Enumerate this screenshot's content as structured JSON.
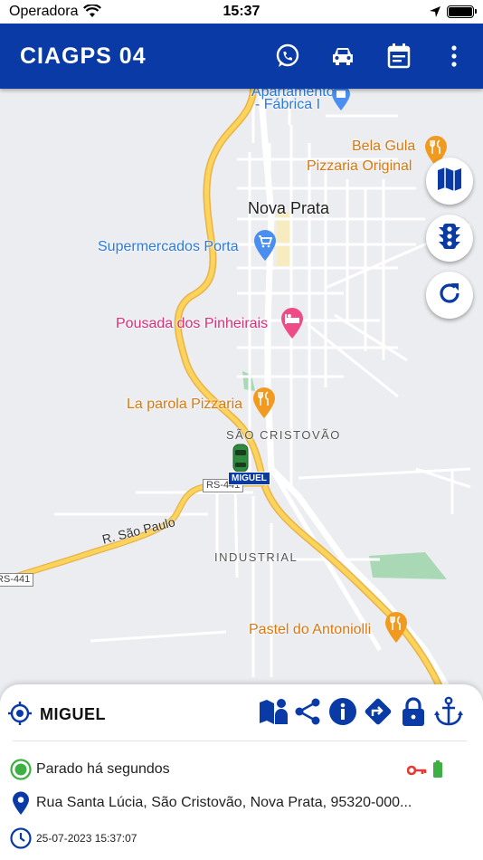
{
  "status_bar": {
    "carrier": "Operadora",
    "time": "15:37",
    "icons": [
      "wifi-icon",
      "location-arrow-icon",
      "battery-icon"
    ]
  },
  "app_bar": {
    "title": "CIAGPS 04",
    "actions": [
      "whatsapp-icon",
      "car-icon",
      "calendar-icon",
      "more-vert-icon"
    ],
    "color": "#0a3aa6"
  },
  "map": {
    "places": {
      "fabrica_partial": "- Fábrica I",
      "fabrica_top_partial": "Apartamentos",
      "bela_gula": "Bela Gula",
      "pizzaria_original": "Pizzaria Original",
      "nova_prata": "Nova Prata",
      "supermercados": "Supermercados Porta",
      "pousada": "Pousada dos Pinheirais",
      "la_parola": "La parola Pizzaria",
      "sao_cristovao": "SÃO CRISTOVÃO",
      "industrial": "INDUSTRIAL",
      "pastel": "Pastel do Antoniolli",
      "r_sao_paulo": "R. São Paulo",
      "rs441_a": "RS-441",
      "rs441_b": "RS-441"
    },
    "vehicle_label": "MIGUEL",
    "buttons": [
      "map-icon",
      "traffic-light-icon",
      "refresh-icon"
    ]
  },
  "sheet": {
    "vehicle_name": "MIGUEL",
    "tools": [
      "map-person-icon",
      "share-icon",
      "info-icon",
      "directions-icon",
      "lock-icon",
      "anchor-icon"
    ],
    "status": "Parado há segundos",
    "address": "Rua Santa Lúcia, São Cristovão, Nova Prata, 95320-000...",
    "datetime": "25-07-2023 15:37:07",
    "colors": {
      "accent": "#0a3aa6",
      "stopped": "#3cb043",
      "ignition_off": "#e53935",
      "battery": "#3cb043"
    }
  }
}
